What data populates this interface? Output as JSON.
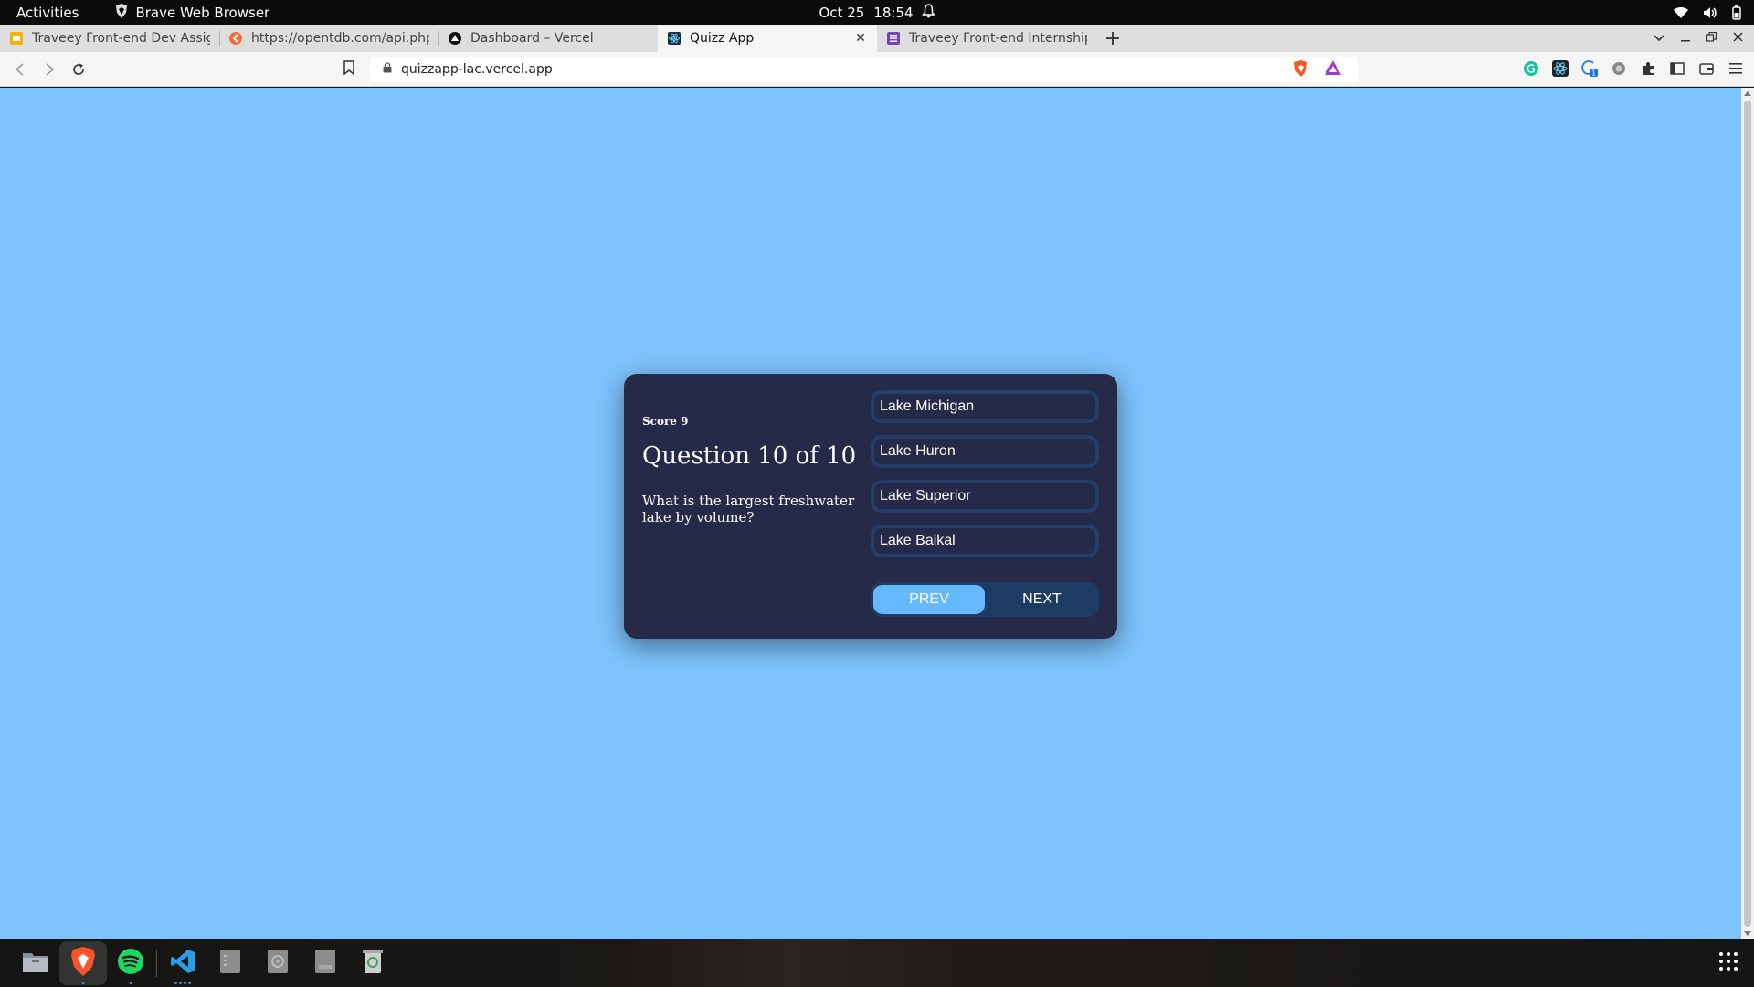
{
  "topbar": {
    "activities": "Activities",
    "app_name": "Brave Web Browser",
    "date": "Oct 25",
    "time": "18:54"
  },
  "tabs": [
    {
      "title": "Traveey Front-end Dev Assign",
      "icon": "slides-icon",
      "active": false
    },
    {
      "title": "https://opentdb.com/api.php",
      "icon": "opentdb-icon",
      "active": false
    },
    {
      "title": "Dashboard – Vercel",
      "icon": "vercel-icon",
      "active": false
    },
    {
      "title": "Quizz App",
      "icon": "react-icon",
      "active": true
    },
    {
      "title": "Traveey Front-end Internship",
      "icon": "forms-icon",
      "active": false
    }
  ],
  "toolbar": {
    "url": "quizzapp-lac.vercel.app"
  },
  "quiz": {
    "score_label": "Score 9",
    "question_label": "Question 10 of 10",
    "question_text": "What is the largest freshwater lake by volume?",
    "answers": [
      "Lake Michigan",
      "Lake Huron",
      "Lake Superior",
      "Lake Baikal"
    ],
    "prev_label": "PREV",
    "next_label": "NEXT"
  },
  "colors": {
    "page_bg": "#7dc3fd",
    "card_bg": "#252a48",
    "answer_border": "#233e69",
    "prev_bg": "#65baff",
    "next_bg": "#1d3b63"
  },
  "dock": {
    "items": [
      "files-icon",
      "brave-icon",
      "spotify-icon",
      "vscode-icon",
      "text-editor-icon",
      "disk-icon",
      "ssd-icon",
      "trash-icon"
    ]
  }
}
